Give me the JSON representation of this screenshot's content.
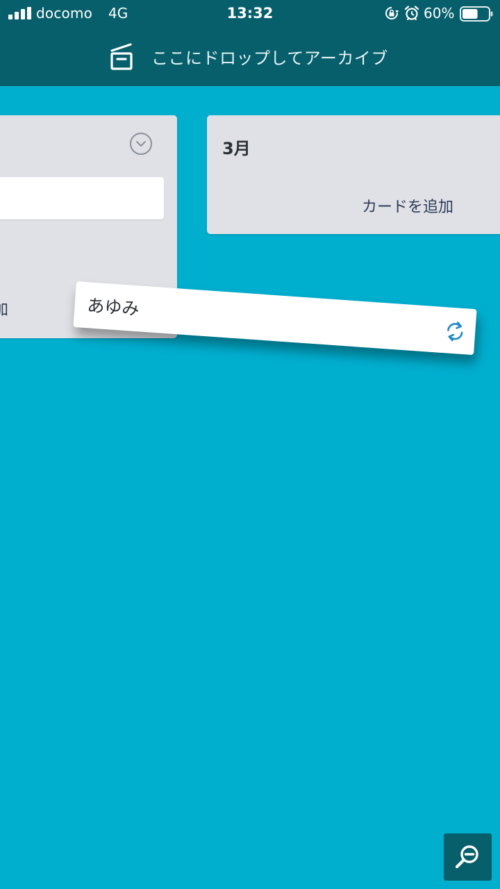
{
  "status_bar": {
    "carrier": "docomo",
    "network": "4G",
    "time": "13:32",
    "battery_percent": "60%",
    "battery_level": 0.6,
    "icons": [
      "signal-icon",
      "rotation-lock-icon",
      "alarm-icon",
      "battery-icon"
    ]
  },
  "archive": {
    "label": "ここにドロップしてアーカイブ",
    "icon": "archive-box-icon"
  },
  "lists": [
    {
      "title": "",
      "add_card_label": "加",
      "icon": "chevron-down-circle-icon"
    },
    {
      "title": "3月",
      "add_card_label": "カードを追加"
    }
  ],
  "dragging_card": {
    "title": "あゆみ",
    "icon": "sync-icon"
  },
  "fab": {
    "icon": "zoom-out-icon"
  },
  "colors": {
    "board_background": "#00AECE",
    "header_background": "#065F6B",
    "list_background": "#DFE1E6",
    "card_background": "#FFFFFF",
    "accent_blue": "#1E88C8"
  }
}
